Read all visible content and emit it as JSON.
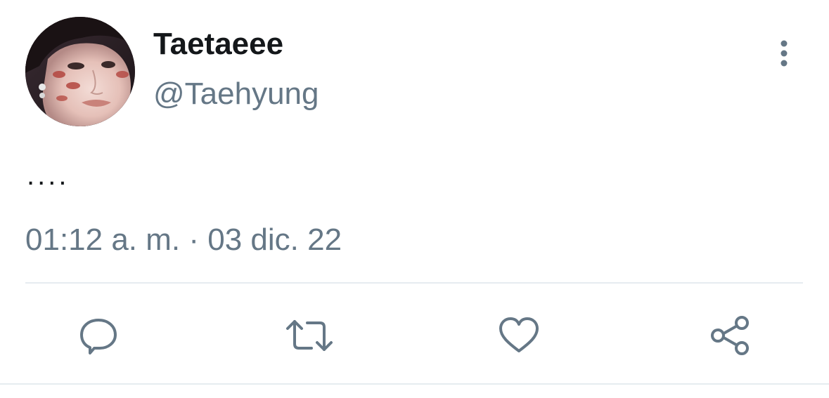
{
  "tweet": {
    "display_name": "Taetaeee",
    "handle": "@Taehyung",
    "text": "....",
    "timestamp": "01:12 a. m. · 03 dic. 22"
  },
  "icons": {
    "more": "more-vertical-icon",
    "reply": "reply-icon",
    "retweet": "retweet-icon",
    "like": "heart-icon",
    "share": "share-icon"
  },
  "colors": {
    "name": "#14171a",
    "secondary": "#657786",
    "divider": "#e6ecf0"
  }
}
